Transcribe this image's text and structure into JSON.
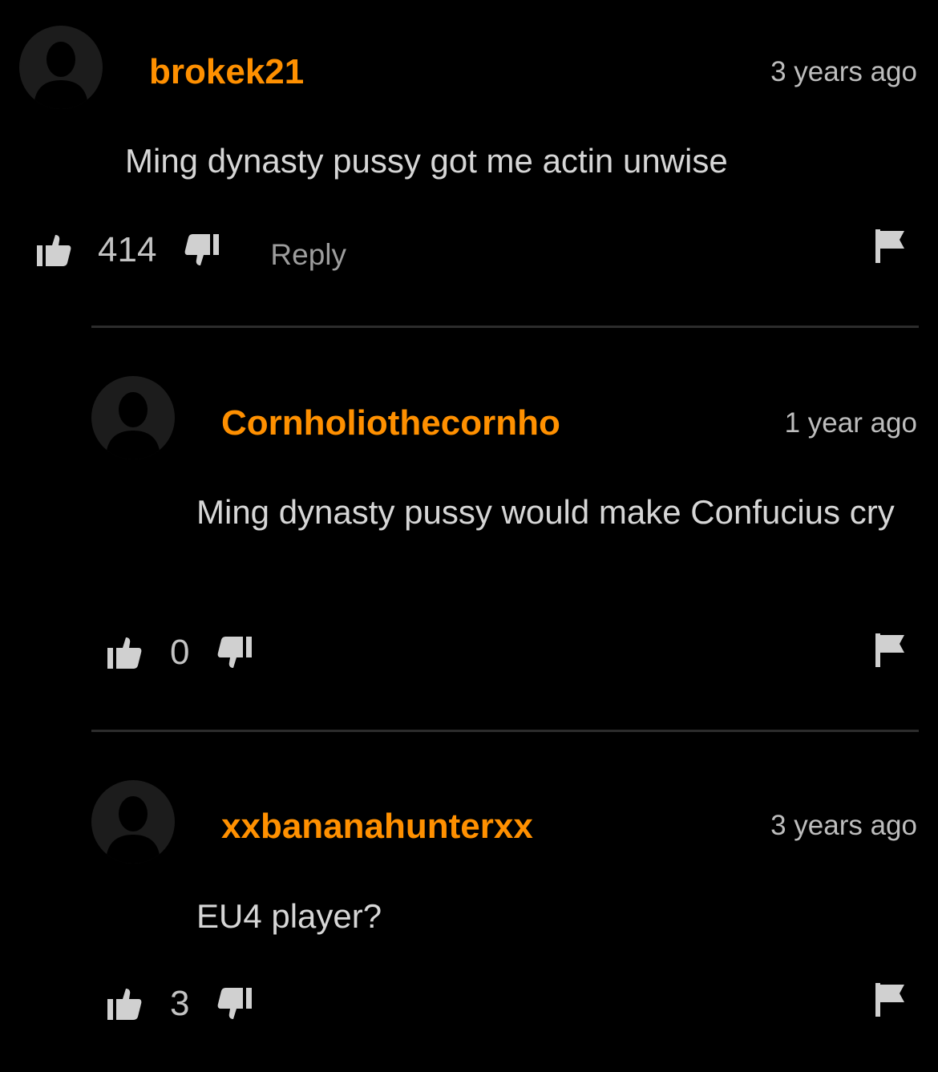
{
  "comments": [
    {
      "username": "brokek21",
      "timestamp": "3 years ago",
      "text": "Ming dynasty pussy got me actin unwise",
      "votes": "414",
      "reply_label": "Reply"
    },
    {
      "username": "Cornholiothecornho",
      "timestamp": "1 year ago",
      "text": "Ming dynasty pussy would make Confucius cry",
      "votes": "0"
    },
    {
      "username": "xxbananahunterxx",
      "timestamp": "3 years ago",
      "text": "EU4 player?",
      "votes": "3"
    }
  ],
  "colors": {
    "username": "#ff9000",
    "background": "#000000",
    "text": "#d6d6d6",
    "icon": "#d0d0d0"
  },
  "icons": {
    "thumbs_up": "thumbs-up-icon",
    "thumbs_down": "thumbs-down-icon",
    "flag": "flag-icon",
    "avatar": "default-avatar-icon"
  }
}
